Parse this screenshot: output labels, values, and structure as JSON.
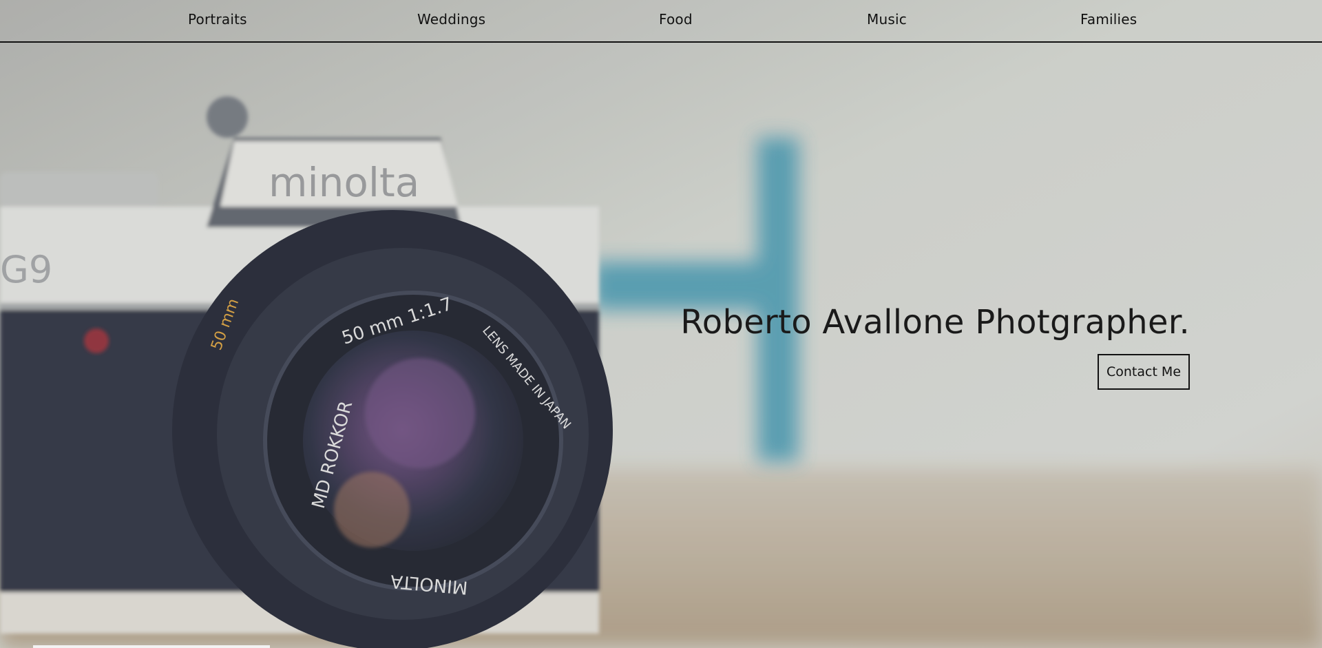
{
  "nav": {
    "items": [
      {
        "label": "Portraits"
      },
      {
        "label": "Weddings"
      },
      {
        "label": "Food"
      },
      {
        "label": "Music"
      },
      {
        "label": "Families"
      }
    ]
  },
  "hero": {
    "title": "Roberto Avallone Photgrapher.",
    "contact_label": "Contact Me",
    "camera_brand": "minolta",
    "camera_model": "MD ROKKOR",
    "lens_text": "50 mm 1:1.7",
    "lens_origin": "LENS MADE IN JAPAN",
    "lens_brand": "MINOLTA"
  },
  "colors": {
    "accent_blue": "#3a8fa8",
    "text": "#111111"
  }
}
